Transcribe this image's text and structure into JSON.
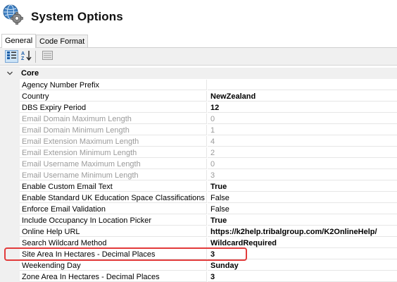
{
  "header": {
    "title": "System Options",
    "icon": "gear-globe-icon"
  },
  "tabs": [
    {
      "label": "General",
      "active": true
    },
    {
      "label": "Code Format",
      "active": false
    }
  ],
  "toolbar": {
    "buttons": [
      {
        "icon": "categorized-view-icon",
        "pressed": true
      },
      {
        "icon": "sort-alphabetical-icon",
        "pressed": false
      },
      {
        "icon": "property-pages-icon",
        "pressed": false
      }
    ]
  },
  "grid": {
    "category": {
      "label": "Core",
      "expanded": true
    },
    "properties": [
      {
        "name": "Agency Number Prefix",
        "value": "",
        "enabled": true,
        "bold": false
      },
      {
        "name": "Country",
        "value": "NewZealand",
        "enabled": true,
        "bold": true
      },
      {
        "name": "DBS Expiry Period",
        "value": "12",
        "enabled": true,
        "bold": true
      },
      {
        "name": "Email Domain Maximum Length",
        "value": "0",
        "enabled": false,
        "bold": false
      },
      {
        "name": "Email Domain Minimum Length",
        "value": "1",
        "enabled": false,
        "bold": false
      },
      {
        "name": "Email Extension Maximum Length",
        "value": "4",
        "enabled": false,
        "bold": false
      },
      {
        "name": "Email Extension Minimum Length",
        "value": "2",
        "enabled": false,
        "bold": false
      },
      {
        "name": "Email Username Maximum Length",
        "value": "0",
        "enabled": false,
        "bold": false
      },
      {
        "name": "Email Username Minimum Length",
        "value": "3",
        "enabled": false,
        "bold": false
      },
      {
        "name": "Enable Custom Email Text",
        "value": "True",
        "enabled": true,
        "bold": true,
        "highlighted": true
      },
      {
        "name": "Enable Standard UK Education Space Classifications",
        "value": "False",
        "enabled": true,
        "bold": false
      },
      {
        "name": "Enforce Email Validation",
        "value": "False",
        "enabled": true,
        "bold": false
      },
      {
        "name": "Include Occupancy In Location Picker",
        "value": "True",
        "enabled": true,
        "bold": true
      },
      {
        "name": "Online Help URL",
        "value": "https://k2help.tribalgroup.com/K2OnlineHelp/",
        "enabled": true,
        "bold": true
      },
      {
        "name": "Search Wildcard Method",
        "value": "WildcardRequired",
        "enabled": true,
        "bold": true
      },
      {
        "name": "Site Area In Hectares - Decimal Places",
        "value": "3",
        "enabled": true,
        "bold": true
      },
      {
        "name": "Weekending Day",
        "value": "Sunday",
        "enabled": true,
        "bold": true
      },
      {
        "name": "Zone Area In Hectares - Decimal Places",
        "value": "3",
        "enabled": true,
        "bold": true
      }
    ]
  },
  "colors": {
    "highlight": "#e23b3b",
    "gutter": "#f0f0f0",
    "disabled_text": "#9a9a9a"
  }
}
